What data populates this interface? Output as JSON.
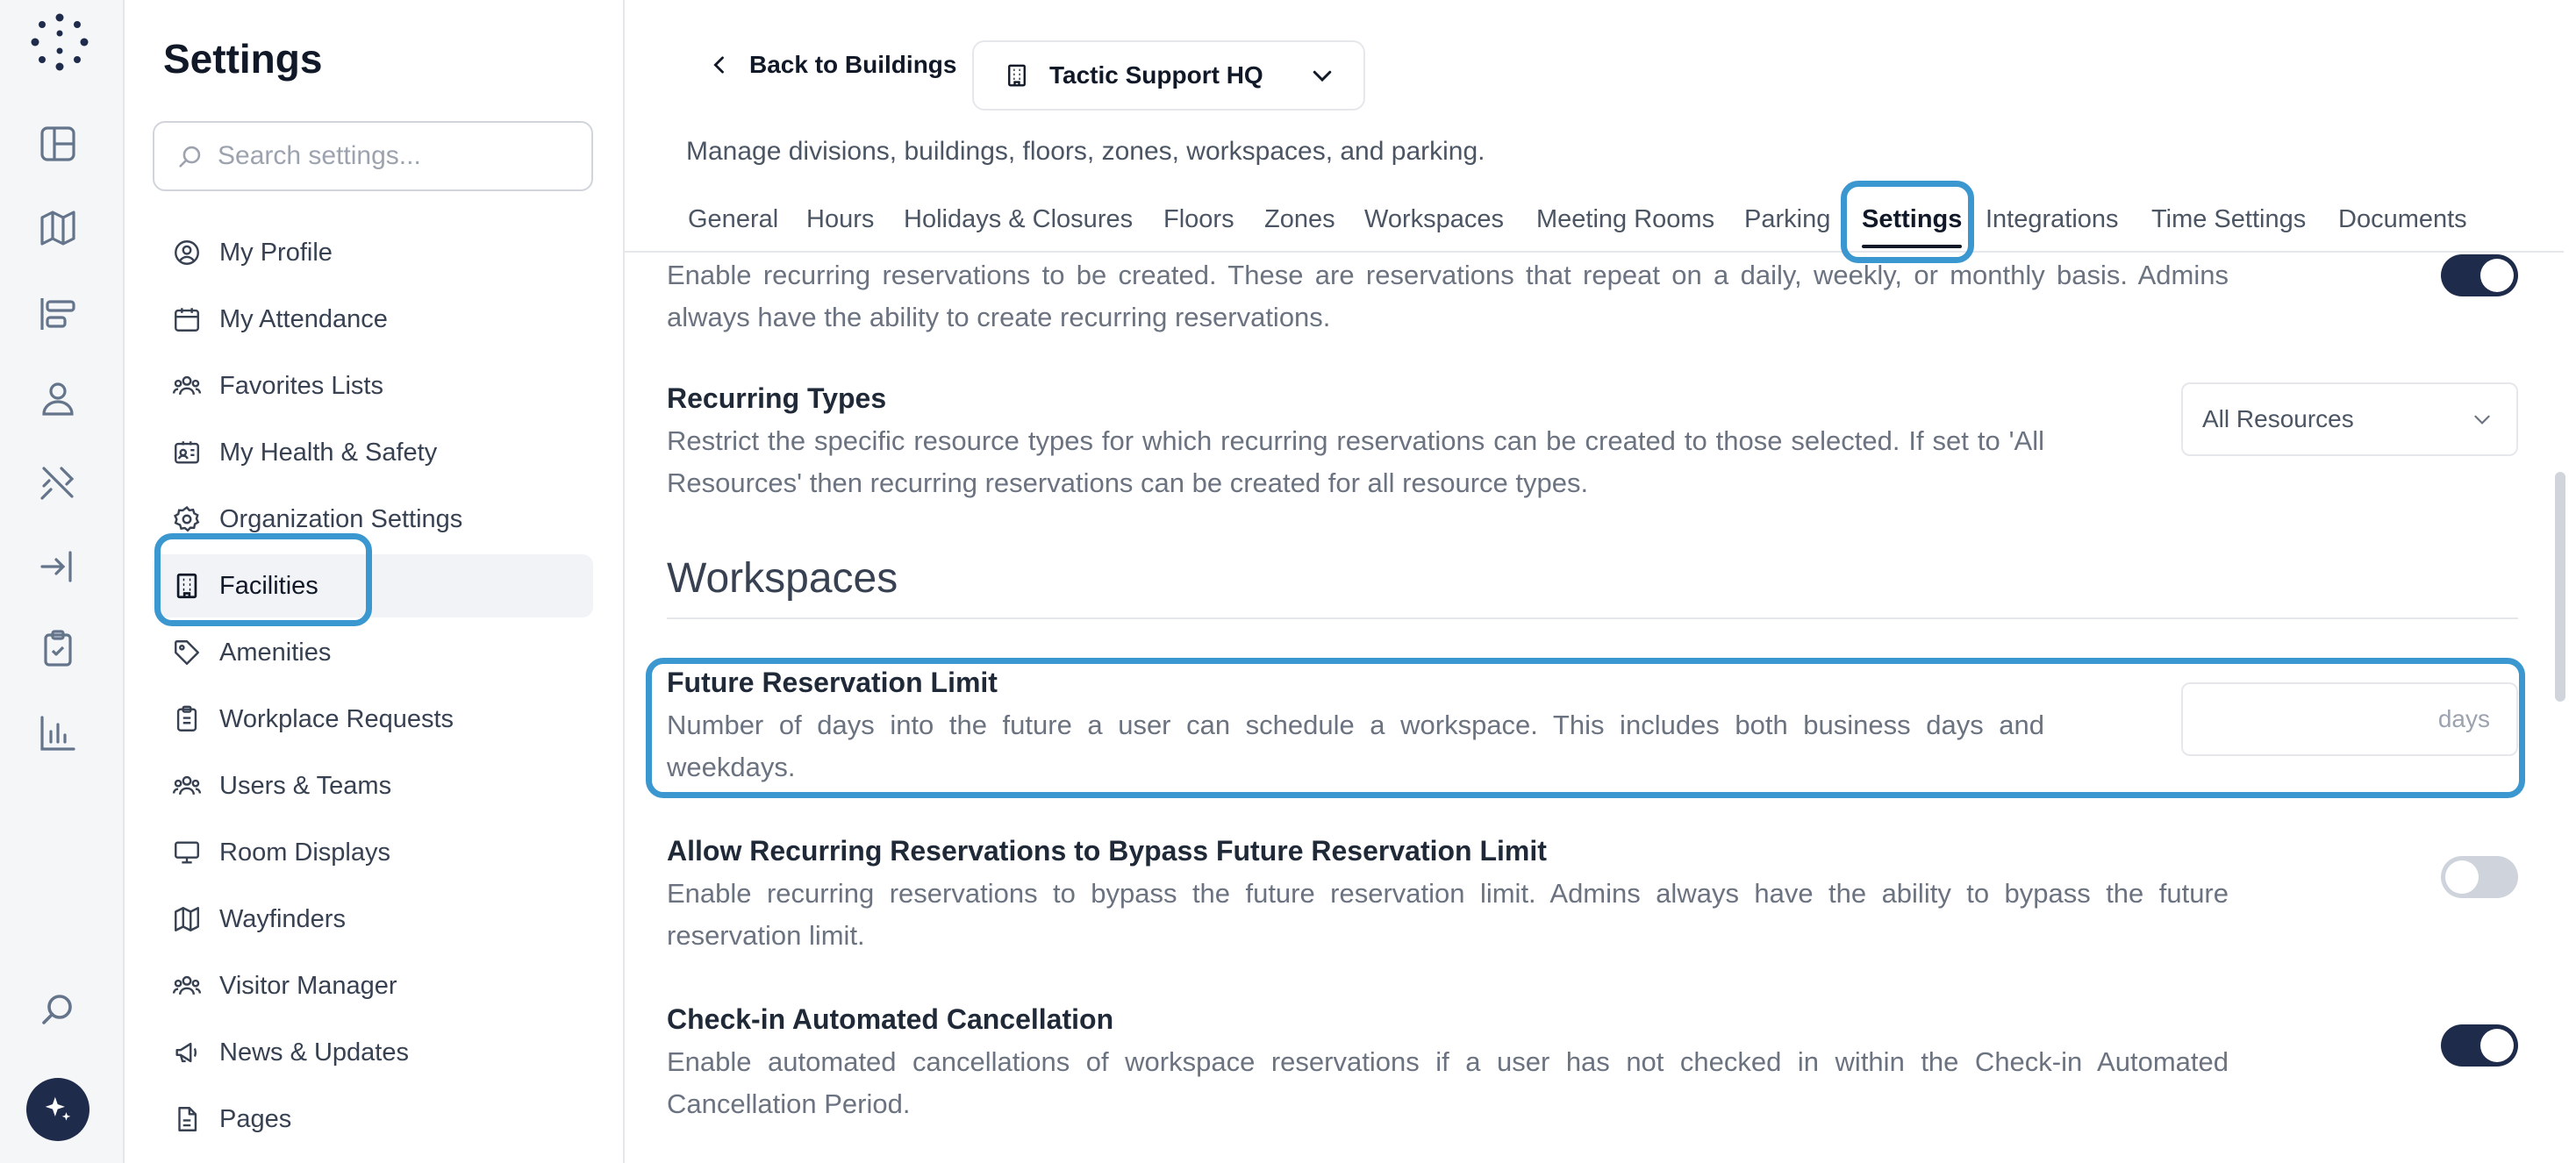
{
  "colors": {
    "highlight": "#3b97cf",
    "toggle_on": "#1e2b4a",
    "toggle_off": "#cfd4dc",
    "active_nav_bg": "#f1f3f6"
  },
  "rail": {
    "icons": [
      "dashboard-icon",
      "map-icon",
      "layout-icon",
      "person-icon",
      "tools-icon",
      "sign-in-icon",
      "clipboard-check-icon",
      "bar-chart-icon",
      "search-icon",
      "sparkle-icon"
    ]
  },
  "sidebar": {
    "title": "Settings",
    "search_placeholder": "Search settings...",
    "items": [
      {
        "label": "My Profile",
        "icon": "user-circle-icon"
      },
      {
        "label": "My Attendance",
        "icon": "calendar-icon"
      },
      {
        "label": "Favorites Lists",
        "icon": "users-icon"
      },
      {
        "label": "My Health & Safety",
        "icon": "id-card-icon"
      },
      {
        "label": "Organization Settings",
        "icon": "gear-icon"
      },
      {
        "label": "Facilities",
        "icon": "building-icon",
        "active": true
      },
      {
        "label": "Amenities",
        "icon": "tag-icon"
      },
      {
        "label": "Workplace Requests",
        "icon": "clipboard-icon"
      },
      {
        "label": "Users & Teams",
        "icon": "users-icon"
      },
      {
        "label": "Room Displays",
        "icon": "monitor-icon"
      },
      {
        "label": "Wayfinders",
        "icon": "map-icon"
      },
      {
        "label": "Visitor Manager",
        "icon": "users-icon"
      },
      {
        "label": "News & Updates",
        "icon": "megaphone-icon"
      },
      {
        "label": "Pages",
        "icon": "document-icon"
      }
    ]
  },
  "header": {
    "back_label": "Back to Buildings",
    "building_name": "Tactic Support HQ",
    "subtitle": "Manage divisions, buildings, floors, zones, workspaces, and parking."
  },
  "tabs": [
    "General",
    "Hours",
    "Holidays & Closures",
    "Floors",
    "Zones",
    "Workspaces",
    "Meeting Rooms",
    "Parking",
    "Settings",
    "Integrations",
    "Time Settings",
    "Documents"
  ],
  "active_tab": "Settings",
  "settings": {
    "recurring_desc": "Enable recurring reservations to be created. These are reservations that repeat on a daily, weekly, or monthly basis. Admins always have the ability to create recurring reservations.",
    "recurring_enabled": true,
    "recurring_types": {
      "title": "Recurring Types",
      "desc": "Restrict the specific resource types for which recurring reservations can be created to those selected. If set to 'All Resources' then recurring reservations can be created for all resource types.",
      "value": "All Resources"
    },
    "section_title": "Workspaces",
    "future_limit": {
      "title": "Future Reservation Limit",
      "desc": "Number of days into the future a user can schedule a workspace. This includes both business days and weekdays.",
      "value": "",
      "unit": "days"
    },
    "bypass": {
      "title": "Allow Recurring Reservations to Bypass Future Reservation Limit",
      "desc": "Enable recurring reservations to bypass the future reservation limit. Admins always have the ability to bypass the future reservation limit.",
      "enabled": false
    },
    "checkin": {
      "title": "Check-in Automated Cancellation",
      "desc": "Enable automated cancellations of workspace reservations if a user has not checked in within the Check-in Automated Cancellation Period.",
      "enabled": true
    }
  }
}
